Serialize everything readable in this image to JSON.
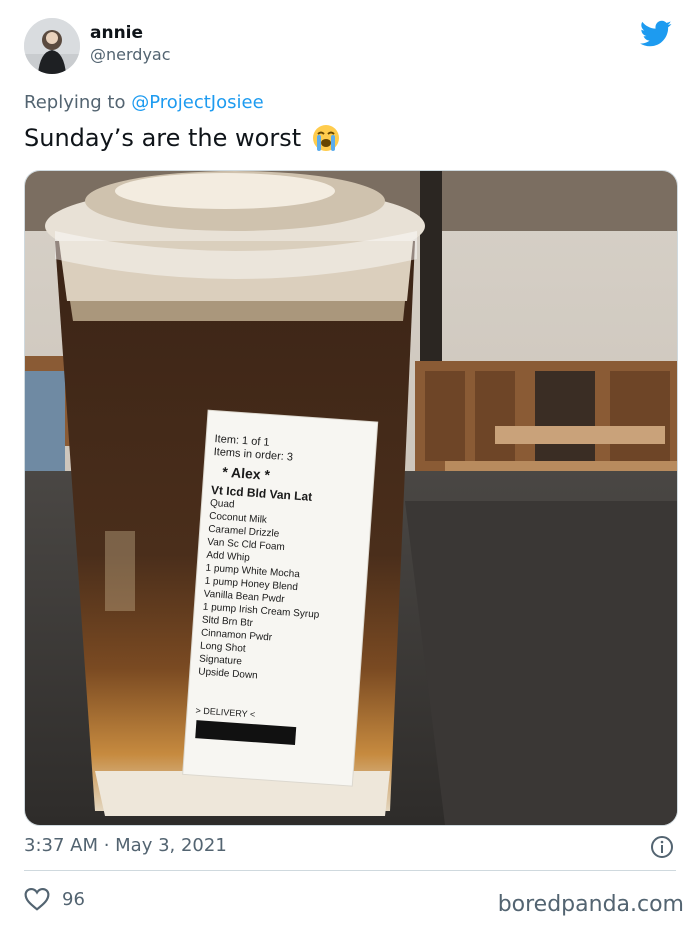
{
  "author": {
    "display_name": "annie",
    "handle": "@nerdyac"
  },
  "reply": {
    "prefix": "Replying to ",
    "mention": "@ProjectJosiee"
  },
  "tweet": {
    "text": "Sunday’s are the worst",
    "emoji": "loudly-crying-face"
  },
  "media": {
    "label": {
      "line1": "Item: 1 of 1",
      "line2": "Items in order: 3",
      "customer": "* Alex *",
      "drink": "Vt Icd Bld Van Lat",
      "mods": [
        "Quad",
        "Coconut Milk",
        "Caramel Drizzle",
        "Van Sc Cld Foam",
        "Add Whip",
        "1 pump White Mocha",
        "1 pump Honey Blend",
        "Vanilla Bean Pwdr",
        "1 pump Irish Cream Syrup",
        "Sltd Brn Btr",
        "Cinnamon Pwdr",
        "Long Shot",
        "Signature",
        "Upside Down"
      ],
      "footer": "> DELIVERY <"
    }
  },
  "meta": {
    "timestamp": "3:37 AM · May 3, 2021"
  },
  "actions": {
    "likes": "96"
  },
  "watermark": "boredpanda.com",
  "colors": {
    "twitter_blue": "#1d9bf0",
    "muted": "#536471",
    "border": "#cfd9de"
  }
}
